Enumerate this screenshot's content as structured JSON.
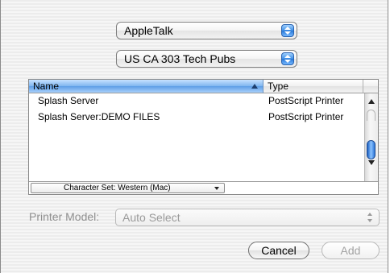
{
  "protocol_popup": {
    "value": "AppleTalk"
  },
  "zone_popup": {
    "value": "US CA 303 Tech Pubs"
  },
  "printer_list": {
    "columns": {
      "name": "Name",
      "type": "Type"
    },
    "rows": [
      {
        "name": "Splash Server",
        "type": "PostScript Printer"
      },
      {
        "name": "Splash Server:DEMO FILES",
        "type": "PostScript Printer"
      }
    ]
  },
  "character_set": {
    "value": "Character Set: Western (Mac)"
  },
  "printer_model": {
    "label": "Printer Model:",
    "value": "Auto Select"
  },
  "buttons": {
    "cancel": "Cancel",
    "add": "Add"
  },
  "icons": [
    "popup-arrows-icon",
    "sort-ascending-icon",
    "scroll-up-arrow-icon",
    "scroll-down-arrow-icon",
    "dropdown-arrow-icon"
  ]
}
